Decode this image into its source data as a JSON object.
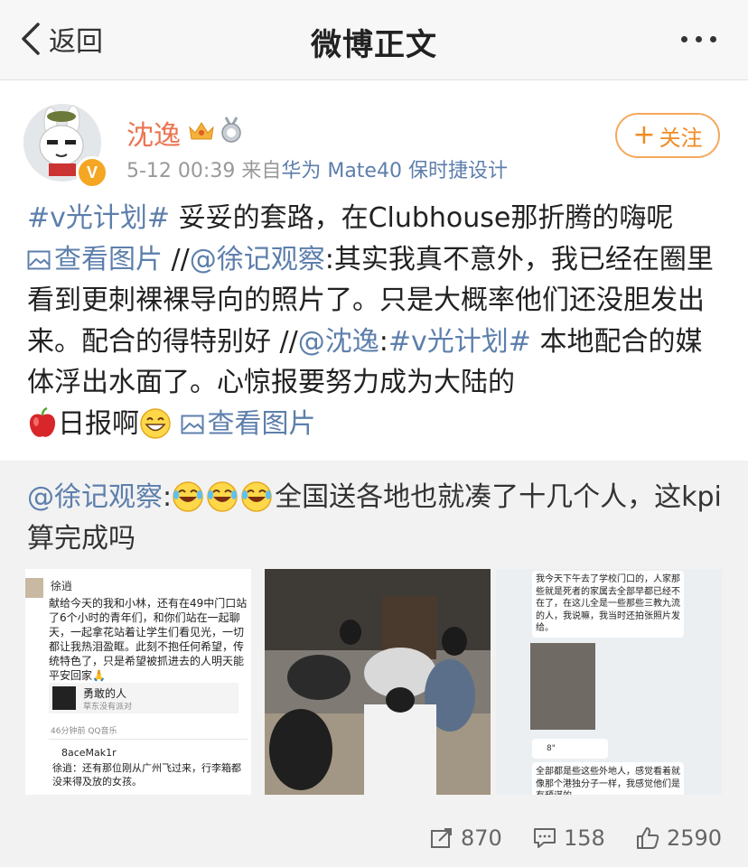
{
  "nav": {
    "back_label": "返回",
    "title": "微博正文"
  },
  "post": {
    "author": "沈逸",
    "time": "5-12 00:39",
    "source_prefix": "来自",
    "device": "华为 Mate40 保时捷设计",
    "follow_label": "关注",
    "text": {
      "topic1": "#v光计划#",
      "seg1": " 妥妥的套路，在Clubhouse那折腾的嗨呢",
      "view_image1": "查看图片",
      "sep1": " //",
      "mention1": "@徐记观察",
      "seg2": ":其实我真不意外，我已经在圈里看到更刺裸裸导向的照片了。只是大概率他们还没胆发出来。配合的得特别好 //",
      "mention2": "@沈逸",
      "colon": ":",
      "topic2": "#v光计划#",
      "seg3": " 本地配合的媒体浮出水面了。心惊报要努力成为大陆的",
      "seg4": "日报啊",
      "view_image2": "查看图片"
    }
  },
  "repost": {
    "mention": "@徐记观察",
    "colon": ":",
    "text": "全国送各地也就凑了十几个人，这kpi算完成吗",
    "image1": {
      "name": "徐逍",
      "body": "献给今天的我和小林，还有在49中门口站了6个小时的青年们，和你们站在一起聊天，一起拿花站着让学生们看见光，一切都让我热泪盈眶。此刻不抱任何希望，传统特色了，只是希望被抓进去的人明天能平安回家🙏",
      "card_title": "勇敢的人",
      "card_sub": "草东没有派对",
      "time": "46分钟前  QQ音乐",
      "reply_user": "8aceMak1r",
      "reply_text": "徐逍：还有那位刚从广州飞过来，行李箱都没来得及放的女孩。"
    },
    "image3": {
      "text1": "我今天下午去了学校门口的，人家那些就是死者的家属去全部早都已经不在了，在这儿全是一些那些三教九流的人，我说嘛，我当时还拍张照片发给。",
      "voice": "8\"",
      "text2": "全部都是些这些外地人，感觉看着就像那个港独分子一样，我感觉他们是有预谋的"
    }
  },
  "actions": {
    "repost_count": "870",
    "comment_count": "158",
    "like_count": "2590"
  },
  "colors": {
    "link": "#5d7fac",
    "username": "#eb7350",
    "follow": "#f08a24"
  }
}
